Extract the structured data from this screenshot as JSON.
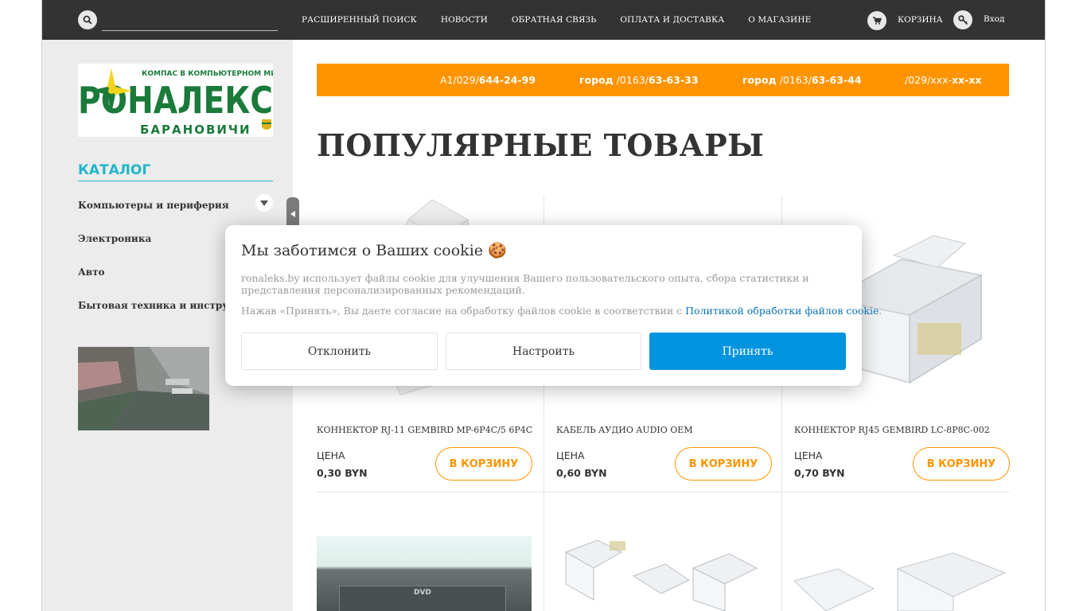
{
  "header": {
    "search_placeholder": "",
    "nav": [
      "РАСШИРЕННЫЙ ПОИСК",
      "НОВОСТИ",
      "ОБРАТНАЯ СВЯЗЬ",
      "ОПЛАТА И ДОСТАВКА",
      "О МАГАЗИНЕ"
    ],
    "cart_label": "КОРЗИНА",
    "login_label": "Вход"
  },
  "sidebar": {
    "logo_top": "КОМПАС В КОМПЬЮТЕРНОМ МИРЕ",
    "logo_main": "РОНАЛЕКС",
    "logo_city": "БАРАНОВИЧИ",
    "catalog_title": "КАТАЛОГ",
    "categories": [
      "Компьютеры и периферия",
      "Электроника",
      "Авто",
      "Бытовая техника и инструмент"
    ]
  },
  "phones": [
    {
      "prefix": "A1/029/",
      "number": "644-24-99"
    },
    {
      "label": "город",
      "prefix": " /0163/",
      "number": "63-63-33"
    },
    {
      "label": "город",
      "prefix": " /0163/",
      "number": "63-63-44"
    },
    {
      "prefix": "/029/xxx-",
      "number": "xx-xx"
    }
  ],
  "section_title": "ПОПУЛЯРНЫЕ ТОВАРЫ",
  "products": [
    {
      "name": "КОННЕКТОР RJ-11 GEMBIRD MP-6P4C/5 6P4C",
      "price_label": "ЦЕНА",
      "price": "0,30 BYN",
      "button": "В КОРЗИНУ"
    },
    {
      "name": "КАБЕЛЬ АУДИО AUDIO OEM",
      "price_label": "ЦЕНА",
      "price": "0,60 BYN",
      "button": "В КОРЗИНУ"
    },
    {
      "name": "КОННЕКТОР RJ45 GEMBIRD LC-8P8C-002",
      "price_label": "ЦЕНА",
      "price": "0,70 BYN",
      "button": "В КОРЗИНУ"
    }
  ],
  "cookie": {
    "title": "Мы заботимся о Ваших cookie 🍪",
    "text": "ronaleks.by использует файлы cookie для улучшения Вашего пользовательского опыта, сбора статистики и представления персонализированных рекомендаций.",
    "text2_before": "Нажав «Принять», Вы даете согласие на обработку файлов cookie в соответствии с ",
    "link": "Политикой обработки файлов cookie",
    "text2_after": ".",
    "decline": "Отклонить",
    "configure": "Настроить",
    "accept": "Принять"
  },
  "colors": {
    "topbar": "#333333",
    "accent_orange": "#ff9400",
    "catalog_teal": "#1fb6c8",
    "accept_blue": "#0094e0",
    "logo_green": "#1a7a3a"
  }
}
